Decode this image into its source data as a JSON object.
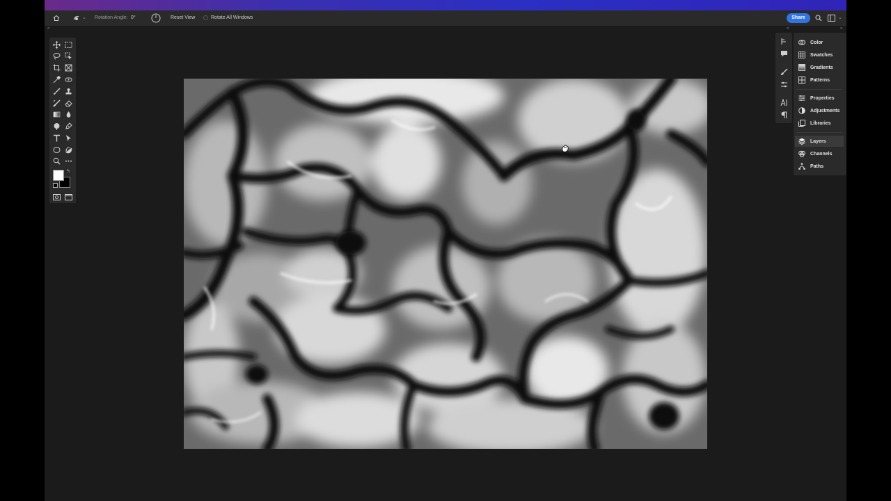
{
  "options_bar": {
    "home_icon": "home-icon",
    "tool_icon": "rotate-view-icon",
    "rotation_label": "Rotation Angle:",
    "rotation_value": "0°",
    "reset_view": "Reset View",
    "rotate_all_windows": "Rotate All Windows",
    "share": "Share"
  },
  "toolbar": {
    "tools": [
      "move-tool",
      "marquee-tool",
      "lasso-tool",
      "object-select-tool",
      "crop-tool",
      "frame-tool",
      "eyedropper-tool",
      "spot-healing-tool",
      "brush-tool",
      "clone-stamp-tool",
      "history-brush-tool",
      "eraser-tool",
      "gradient-tool",
      "blur-tool",
      "dodge-tool",
      "pen-tool",
      "type-tool",
      "path-select-tool",
      "ellipse-tool",
      "hand-rotate-tool",
      "zoom-tool",
      "more-tools"
    ],
    "foreground_color": "#ffffff",
    "background_color": "#000000"
  },
  "panels": {
    "items": [
      {
        "label": "Color",
        "icon": "color-icon"
      },
      {
        "label": "Swatches",
        "icon": "swatches-icon"
      },
      {
        "label": "Gradients",
        "icon": "gradients-icon"
      },
      {
        "label": "Patterns",
        "icon": "patterns-icon"
      },
      {
        "label": "Properties",
        "icon": "properties-icon"
      },
      {
        "label": "Adjustments",
        "icon": "adjustments-icon"
      },
      {
        "label": "Libraries",
        "icon": "libraries-icon"
      },
      {
        "label": "Layers",
        "icon": "layers-icon"
      },
      {
        "label": "Channels",
        "icon": "channels-icon"
      },
      {
        "label": "Paths",
        "icon": "paths-icon"
      }
    ],
    "active": "Layers"
  },
  "colors": {
    "accent": "#2f74e0",
    "app_bg": "#1b1b1b",
    "panel_bg": "#2a2a2a"
  }
}
